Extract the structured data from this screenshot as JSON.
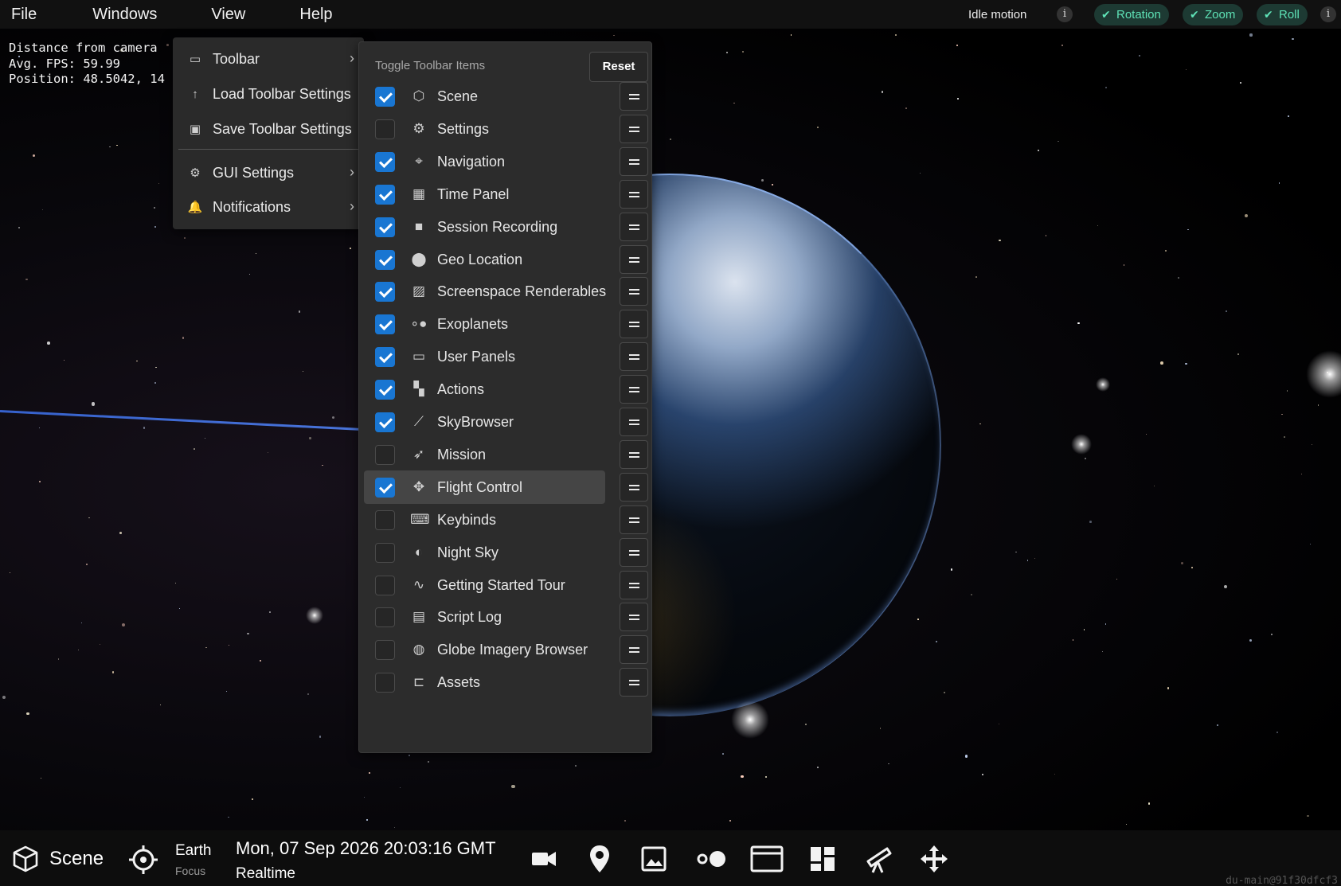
{
  "menubar": {
    "items": [
      "File",
      "Windows",
      "View",
      "Help"
    ],
    "idle_motion_label": "Idle motion",
    "pills": [
      "Rotation",
      "Zoom",
      "Roll"
    ]
  },
  "debug": {
    "line1": "Distance from camera",
    "line2": "Avg. FPS: 59.99",
    "line3": "Position: 48.5042, 14"
  },
  "view_menu": {
    "items": [
      {
        "label": "Toolbar",
        "icon": "toolbar-icon",
        "has_submenu": true
      },
      {
        "label": "Load Toolbar Settings",
        "icon": "upload-arrow-icon",
        "has_submenu": false
      },
      {
        "label": "Save Toolbar Settings",
        "icon": "save-icon",
        "has_submenu": false
      },
      {
        "label": "GUI Settings",
        "icon": "gear-icon",
        "has_submenu": true
      },
      {
        "label": "Notifications",
        "icon": "bell-icon",
        "has_submenu": true
      }
    ]
  },
  "toolbar_panel": {
    "title": "Toggle Toolbar Items",
    "reset_label": "Reset",
    "items": [
      {
        "label": "Scene",
        "checked": true,
        "icon": "cube-icon"
      },
      {
        "label": "Settings",
        "checked": false,
        "icon": "gear-icon"
      },
      {
        "label": "Navigation",
        "checked": true,
        "icon": "crosshair-icon"
      },
      {
        "label": "Time Panel",
        "checked": true,
        "icon": "calendar-icon"
      },
      {
        "label": "Session Recording",
        "checked": true,
        "icon": "video-camera-icon"
      },
      {
        "label": "Geo Location",
        "checked": true,
        "icon": "map-pin-icon"
      },
      {
        "label": "Screenspace Renderables",
        "checked": true,
        "icon": "image-icon"
      },
      {
        "label": "Exoplanets",
        "checked": true,
        "icon": "exoplanet-icon"
      },
      {
        "label": "User Panels",
        "checked": true,
        "icon": "browser-window-icon"
      },
      {
        "label": "Actions",
        "checked": true,
        "icon": "dashboard-icon"
      },
      {
        "label": "SkyBrowser",
        "checked": true,
        "icon": "telescope-icon"
      },
      {
        "label": "Mission",
        "checked": false,
        "icon": "rocket-icon"
      },
      {
        "label": "Flight Control",
        "checked": true,
        "icon": "move-arrows-icon",
        "hovered": true
      },
      {
        "label": "Keybinds",
        "checked": false,
        "icon": "keyboard-icon"
      },
      {
        "label": "Night Sky",
        "checked": false,
        "icon": "night-sky-icon"
      },
      {
        "label": "Getting Started Tour",
        "checked": false,
        "icon": "route-icon"
      },
      {
        "label": "Script Log",
        "checked": false,
        "icon": "script-icon"
      },
      {
        "label": "Globe Imagery Browser",
        "checked": false,
        "icon": "globe-icon"
      },
      {
        "label": "Assets",
        "checked": false,
        "icon": "folder-open-icon"
      }
    ]
  },
  "bottombar": {
    "scene_label": "Scene",
    "focus_name": "Earth",
    "focus_sub": "Focus",
    "time": "Mon, 07 Sep 2026 20:03:16 GMT",
    "rate": "Realtime",
    "tools": [
      "video-camera-icon",
      "map-pin-icon",
      "image-icon",
      "exoplanet-icon",
      "browser-window-icon",
      "dashboard-icon",
      "telescope-icon",
      "move-arrows-icon"
    ],
    "build": "du-main@91f30dfcf3"
  },
  "colors": {
    "accent": "#1976d2",
    "pill_bg": "#1d3a33",
    "pill_text": "#5ee2b6",
    "panel_bg": "#2c2c2c"
  }
}
